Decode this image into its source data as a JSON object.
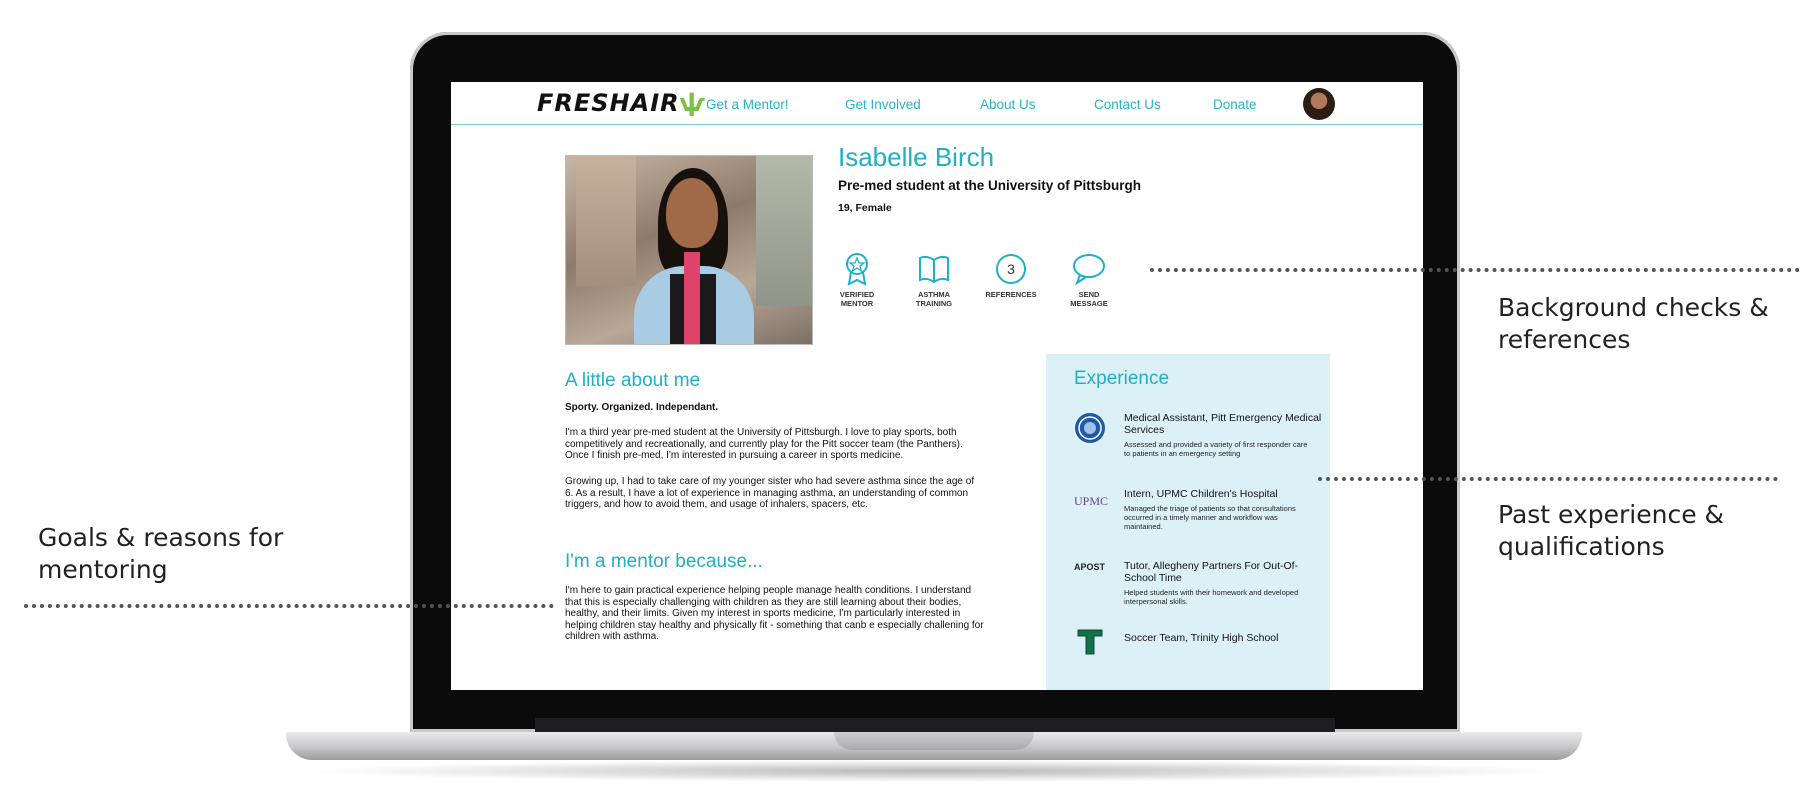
{
  "nav": {
    "logo": "FRESHAIR",
    "links": [
      "Get a Mentor!",
      "Get Involved",
      "About Us",
      "Contact Us",
      "Donate"
    ]
  },
  "profile": {
    "name": "Isabelle Birch",
    "tagline": "Pre-med student at the University of Pittsburgh",
    "meta": "19, Female",
    "badges": [
      {
        "label": "VERIFIED\nMENTOR",
        "icon": "award-icon"
      },
      {
        "label": "ASTHMA\nTRAINING",
        "icon": "book-icon"
      },
      {
        "label": "REFERENCES",
        "icon": "references-count-icon",
        "count": "3"
      },
      {
        "label": "SEND\nMESSAGE",
        "icon": "chat-bubble-icon"
      }
    ]
  },
  "about": {
    "title": "A little about me",
    "traits": "Sporty. Organized. Independant.",
    "p1": "I'm a third year pre-med student at the University of Pittsburgh. I love to play sports, both competitively and recreationally, and currently play for the Pitt soccer team (the Panthers). Once I finish pre-med, I'm interested in pursuing a career in sports medicine.",
    "p2": "Growing up, I had to take care of my younger sister who had severe asthma since the age of 6. As a result, I have a lot of experience in managing asthma, an understanding of common triggers, and how to avoid them, and usage of inhalers, spacers, etc."
  },
  "mentor": {
    "title": "I'm a mentor because...",
    "p": "I'm here to gain practical experience helping people manage health conditions. I understand that this is especially challenging with children as they are still learning about their bodies, healthy, and their limits. Given my interest in sports medicine, I'm particularly interested in helping children stay healthy and physically fit - something that canb e especially challening for children with asthma."
  },
  "experience": {
    "title": "Experience",
    "items": [
      {
        "title": "Medical Assistant, Pitt Emergency Medical Services",
        "desc": "Assessed and provided a variety of first responder care to patients in an emergency setting",
        "logo": "pitt-seal-icon"
      },
      {
        "title": "Intern, UPMC Children's Hospital",
        "desc": "Managed the triage of patients so that consultations occurred in a timely manner and workflow was maintained.",
        "logo": "UPMC"
      },
      {
        "title": "Tutor, Allegheny Partners For Out-Of-School Time",
        "desc": "Helped students with their homework and developed interpersonal skills.",
        "logo": "APOST"
      },
      {
        "title": "Soccer Team, Trinity High School",
        "desc": "",
        "logo": "trinity-t-icon"
      }
    ]
  },
  "annotations": {
    "background": "Background checks &\nreferences",
    "experience": "Past experience &\nqualifications",
    "goals": "Goals & reasons for\nmentoring"
  },
  "colors": {
    "accent": "#1fb0c5",
    "panel": "#dcf1f7",
    "sprout": "#7cc242"
  }
}
